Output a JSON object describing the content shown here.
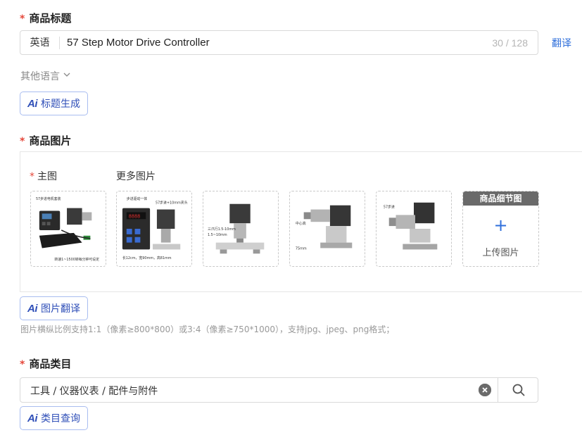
{
  "title_section": {
    "label": "商品标题",
    "required_mark": "*",
    "language": "英语",
    "value": "57 Step Motor Drive Controller",
    "char_count": "30 / 128",
    "translate_label": "翻译",
    "other_languages_label": "其他语言",
    "ai_title_button": "标题生成"
  },
  "images_section": {
    "label": "商品图片",
    "required_mark": "*",
    "main_image_label": "主图",
    "more_images_label": "更多图片",
    "thumbnails": [
      {
        "caption_top": "57步进电机套装",
        "caption_bottom": "转速1~1500转每分钟可设定"
      },
      {
        "caption_top": "步进驱动一体",
        "caption_side": "57步进+10mm夹头",
        "caption_bottom": "长12cm，宽90mm，高81mm"
      },
      {
        "caption_side": "三爪行1.5-10mm",
        "caption_bottom": "1.5~10mm"
      },
      {
        "caption_side": "中心高",
        "caption_bottom": "75mm"
      },
      {
        "caption_side": "57步进"
      }
    ],
    "detail_header": "商品细节图",
    "upload_label": "上传图片",
    "ai_translate_button": "图片翻译",
    "hint": "图片横纵比例支持1:1（像素≥800*800）或3:4（像素≥750*1000），支持jpg、jpeg、png格式；"
  },
  "category_section": {
    "label": "商品类目",
    "required_mark": "*",
    "value": "工具 / 仪器仪表 / 配件与附件",
    "ai_query_button": "类目查询"
  },
  "ai_icon_text": "Ai",
  "colors": {
    "accent": "#2f6fdb",
    "required": "#e5483b",
    "ai_border": "#a9bdf0"
  }
}
